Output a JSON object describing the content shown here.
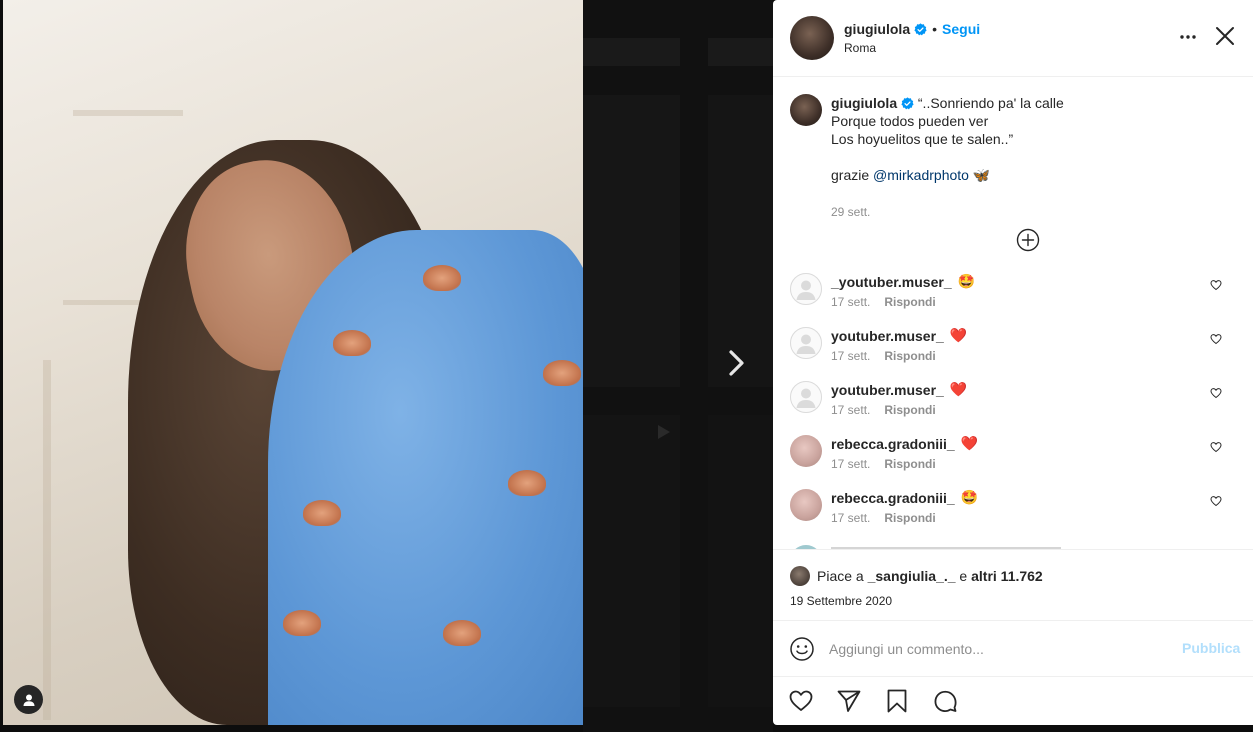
{
  "post": {
    "username": "giugiulola",
    "follow_label": "Segui",
    "separator": "•",
    "location": "Roma",
    "caption_username": "giugiulola",
    "caption_lines": "“..Sonriendo pa' la calle\nPorque todos pueden ver\nLos hoyuelitos que te salen..”",
    "caption_thanks": "grazie",
    "caption_mention": "@mirkadrphoto",
    "caption_emoji": "🦋",
    "caption_date": "29 sett."
  },
  "comments": [
    {
      "username": "_youtuber.muser_",
      "emoji": "🤩",
      "date": "17 sett.",
      "reply": "Rispondi",
      "avatar": "default"
    },
    {
      "username": "youtuber.muser_",
      "emoji": "❤️",
      "date": "17 sett.",
      "reply": "Rispondi",
      "avatar": "default"
    },
    {
      "username": "youtuber.muser_",
      "emoji": "❤️",
      "date": "17 sett.",
      "reply": "Rispondi",
      "avatar": "default"
    },
    {
      "username": "rebecca.gradoniii_",
      "emoji": "❤️",
      "date": "17 sett.",
      "reply": "Rispondi",
      "avatar": "photo"
    },
    {
      "username": "rebecca.gradoniii_",
      "emoji": "🤩",
      "date": "17 sett.",
      "reply": "Rispondi",
      "avatar": "photo"
    }
  ],
  "likes": {
    "prefix": "Piace a",
    "user": "_sangiulia_._",
    "middle": "e",
    "others": "altri 11.762"
  },
  "post_date": "19 Settembre 2020",
  "add_comment": {
    "placeholder": "Aggiungi un commento...",
    "publish_label": "Pubblica"
  },
  "colors": {
    "accent": "#0095f6",
    "publish_disabled": "#b2dffc",
    "heart_red": "#ed4956",
    "muted": "#8e8e8e"
  },
  "icons": [
    "more-options-icon",
    "close-icon",
    "verified-badge-icon",
    "plus-circle-icon",
    "heart-icon",
    "share-icon",
    "bookmark-icon",
    "comment-icon",
    "emoji-icon",
    "next-arrow-icon",
    "user-tag-icon"
  ]
}
